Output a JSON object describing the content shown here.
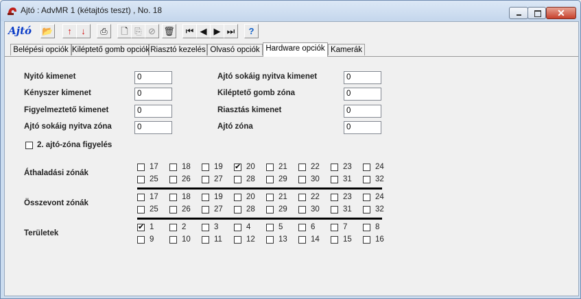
{
  "window": {
    "title": "Ajtó : AdvMR 1 (kétajtós teszt) , No. 18",
    "min_glyph": "–",
    "max_glyph": "□",
    "close_glyph": "✕"
  },
  "toolbar": {
    "label": "Ajtó",
    "buttons": [
      {
        "name": "open-folder-icon",
        "glyph": "📂",
        "color": "#5a7a1a"
      },
      {
        "name": "arrow-up-icon",
        "glyph": "↑",
        "color": "#d01010"
      },
      {
        "name": "arrow-down-icon",
        "glyph": "↓",
        "color": "#d01010"
      },
      {
        "name": "printer-icon",
        "glyph": "⎙",
        "color": "#222222"
      },
      {
        "name": "new-document-icon",
        "glyph": "🗋",
        "color": "#222222"
      },
      {
        "name": "copy-document-icon",
        "glyph": "⎘",
        "color": "#8a8a8a"
      },
      {
        "name": "cancel-icon",
        "glyph": "⊘",
        "color": "#8a8a8a"
      },
      {
        "name": "trash-icon",
        "glyph": "🗑",
        "color": "#222222"
      },
      {
        "name": "first-record-icon",
        "glyph": "⏮",
        "color": "#111111"
      },
      {
        "name": "previous-record-icon",
        "glyph": "◀",
        "color": "#111111"
      },
      {
        "name": "next-record-icon",
        "glyph": "▶",
        "color": "#111111"
      },
      {
        "name": "last-record-icon",
        "glyph": "⏭",
        "color": "#111111"
      },
      {
        "name": "help-icon",
        "glyph": "?",
        "color": "#1060c8"
      }
    ]
  },
  "tabs": [
    {
      "label": "Belépési opciók",
      "active": false
    },
    {
      "label": "Kiléptető gomb opciók",
      "active": false
    },
    {
      "label": "Riasztó kezelés",
      "active": false
    },
    {
      "label": "Olvasó opciók",
      "active": false
    },
    {
      "label": "Hardware opciók",
      "active": true
    },
    {
      "label": "Kamerák",
      "active": false
    }
  ],
  "fields": {
    "left": [
      {
        "label": "Nyitó kimenet",
        "value": "0"
      },
      {
        "label": "Kényszer kimenet",
        "value": "0"
      },
      {
        "label": "Figyelmeztető kimenet",
        "value": "0"
      },
      {
        "label": "Ajtó sokáig nyitva zóna",
        "value": "0"
      }
    ],
    "right": [
      {
        "label": "Ajtó sokáig nyitva kimenet",
        "value": "0"
      },
      {
        "label": "Kiléptető gomb zóna",
        "value": "0"
      },
      {
        "label": "Riasztás kimenet",
        "value": "0"
      },
      {
        "label": "Ajtó zóna",
        "value": "0"
      }
    ]
  },
  "door_zone_monitor": {
    "label": "2. ajtó-zóna figyelés",
    "checked": false
  },
  "groups": [
    {
      "label": "Áthaladási zónák",
      "items": [
        {
          "n": "17",
          "checked": false
        },
        {
          "n": "18",
          "checked": false
        },
        {
          "n": "19",
          "checked": false
        },
        {
          "n": "20",
          "checked": true
        },
        {
          "n": "21",
          "checked": false
        },
        {
          "n": "22",
          "checked": false
        },
        {
          "n": "23",
          "checked": false
        },
        {
          "n": "24",
          "checked": false
        },
        {
          "n": "25",
          "checked": false
        },
        {
          "n": "26",
          "checked": false
        },
        {
          "n": "27",
          "checked": false
        },
        {
          "n": "28",
          "checked": false
        },
        {
          "n": "29",
          "checked": false
        },
        {
          "n": "30",
          "checked": false
        },
        {
          "n": "31",
          "checked": false
        },
        {
          "n": "32",
          "checked": false
        }
      ]
    },
    {
      "label": "Összevont zónák",
      "items": [
        {
          "n": "17",
          "checked": false
        },
        {
          "n": "18",
          "checked": false
        },
        {
          "n": "19",
          "checked": false
        },
        {
          "n": "20",
          "checked": false
        },
        {
          "n": "21",
          "checked": false
        },
        {
          "n": "22",
          "checked": false
        },
        {
          "n": "23",
          "checked": false
        },
        {
          "n": "24",
          "checked": false
        },
        {
          "n": "25",
          "checked": false
        },
        {
          "n": "26",
          "checked": false
        },
        {
          "n": "27",
          "checked": false
        },
        {
          "n": "28",
          "checked": false
        },
        {
          "n": "29",
          "checked": false
        },
        {
          "n": "30",
          "checked": false
        },
        {
          "n": "31",
          "checked": false
        },
        {
          "n": "32",
          "checked": false
        }
      ]
    },
    {
      "label": "Területek",
      "items": [
        {
          "n": "1",
          "checked": true
        },
        {
          "n": "2",
          "checked": false
        },
        {
          "n": "3",
          "checked": false
        },
        {
          "n": "4",
          "checked": false
        },
        {
          "n": "5",
          "checked": false
        },
        {
          "n": "6",
          "checked": false
        },
        {
          "n": "7",
          "checked": false
        },
        {
          "n": "8",
          "checked": false
        },
        {
          "n": "9",
          "checked": false
        },
        {
          "n": "10",
          "checked": false
        },
        {
          "n": "11",
          "checked": false
        },
        {
          "n": "12",
          "checked": false
        },
        {
          "n": "13",
          "checked": false
        },
        {
          "n": "14",
          "checked": false
        },
        {
          "n": "15",
          "checked": false
        },
        {
          "n": "16",
          "checked": false
        }
      ]
    }
  ],
  "check_glyph": "✔"
}
